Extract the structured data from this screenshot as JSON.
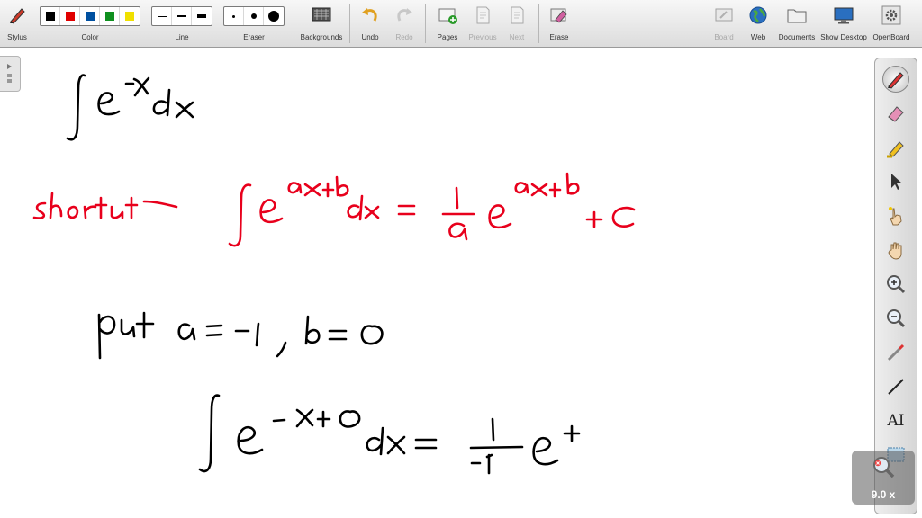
{
  "toolbar": {
    "stylus": "Stylus",
    "color": "Color",
    "line": "Line",
    "eraser": "Eraser",
    "backgrounds": "Backgrounds",
    "undo": "Undo",
    "redo": "Redo",
    "pages": "Pages",
    "previous": "Previous",
    "next": "Next",
    "erase": "Erase",
    "board": "Board",
    "web": "Web",
    "documents": "Documents",
    "show_desktop": "Show Desktop",
    "openboard": "OpenBoard",
    "colors": [
      "#000000",
      "#e00000",
      "#0050a0",
      "#109020",
      "#f0e000"
    ]
  },
  "ink": {
    "black": "#000000",
    "red": "#e8001c"
  },
  "palette": {
    "text_tool": "AI"
  },
  "zoom": {
    "value": "9.0 x"
  }
}
